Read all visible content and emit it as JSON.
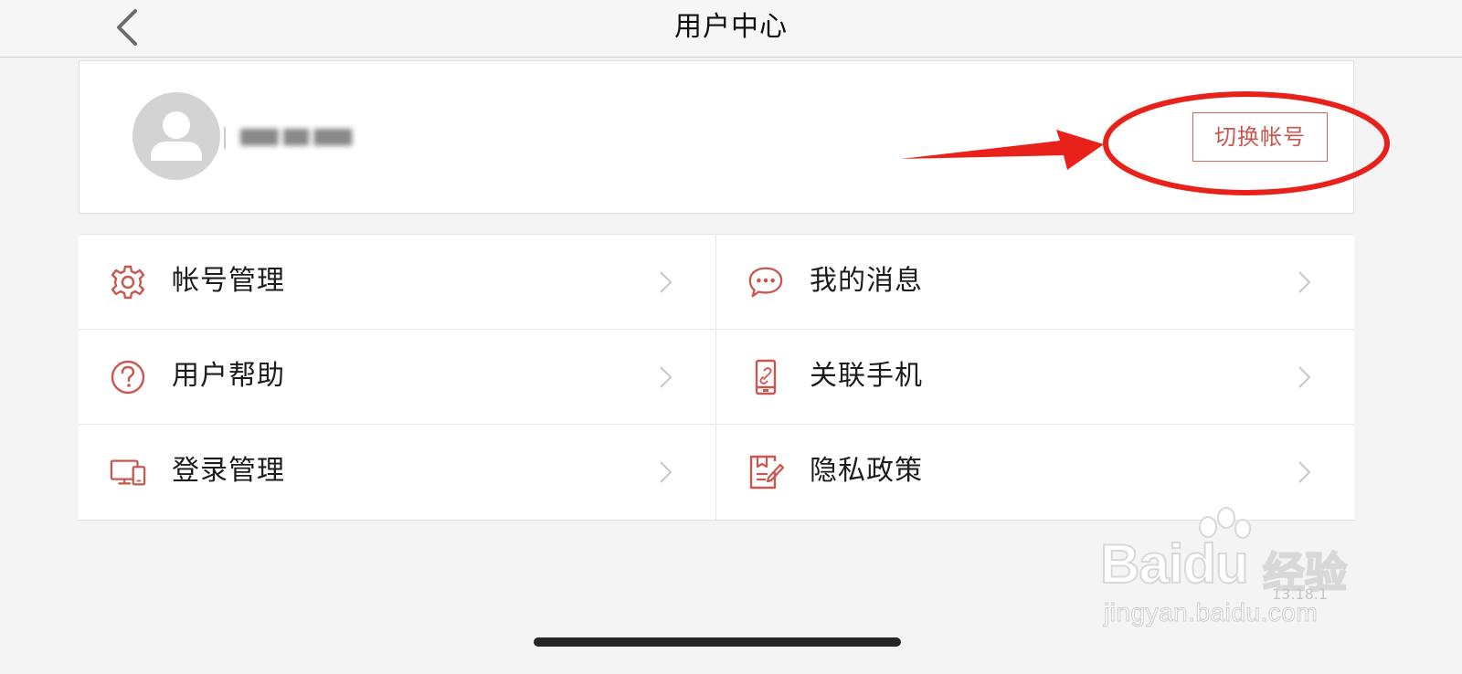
{
  "navbar": {
    "title": "用户中心",
    "back_icon": "chevron-left-icon"
  },
  "profile": {
    "username": "▇▇▇ ▇▇ ▇▇▇",
    "switch_account_label": "切换帐号"
  },
  "menu": {
    "items": [
      {
        "label": "帐号管理",
        "icon": "gear-icon"
      },
      {
        "label": "我的消息",
        "icon": "chat-bubble-icon"
      },
      {
        "label": "用户帮助",
        "icon": "question-circle-icon"
      },
      {
        "label": "关联手机",
        "icon": "phone-link-icon"
      },
      {
        "label": "登录管理",
        "icon": "devices-icon"
      },
      {
        "label": "隐私政策",
        "icon": "document-edit-icon"
      }
    ]
  },
  "watermark": {
    "brand": "Baidu",
    "brand_suffix": "经验",
    "version": "13.18.1",
    "url": "jingyan.baidu.com"
  },
  "colors": {
    "accent": "#c9574f",
    "annotation": "#e8221b",
    "background": "#f4f4f4"
  }
}
